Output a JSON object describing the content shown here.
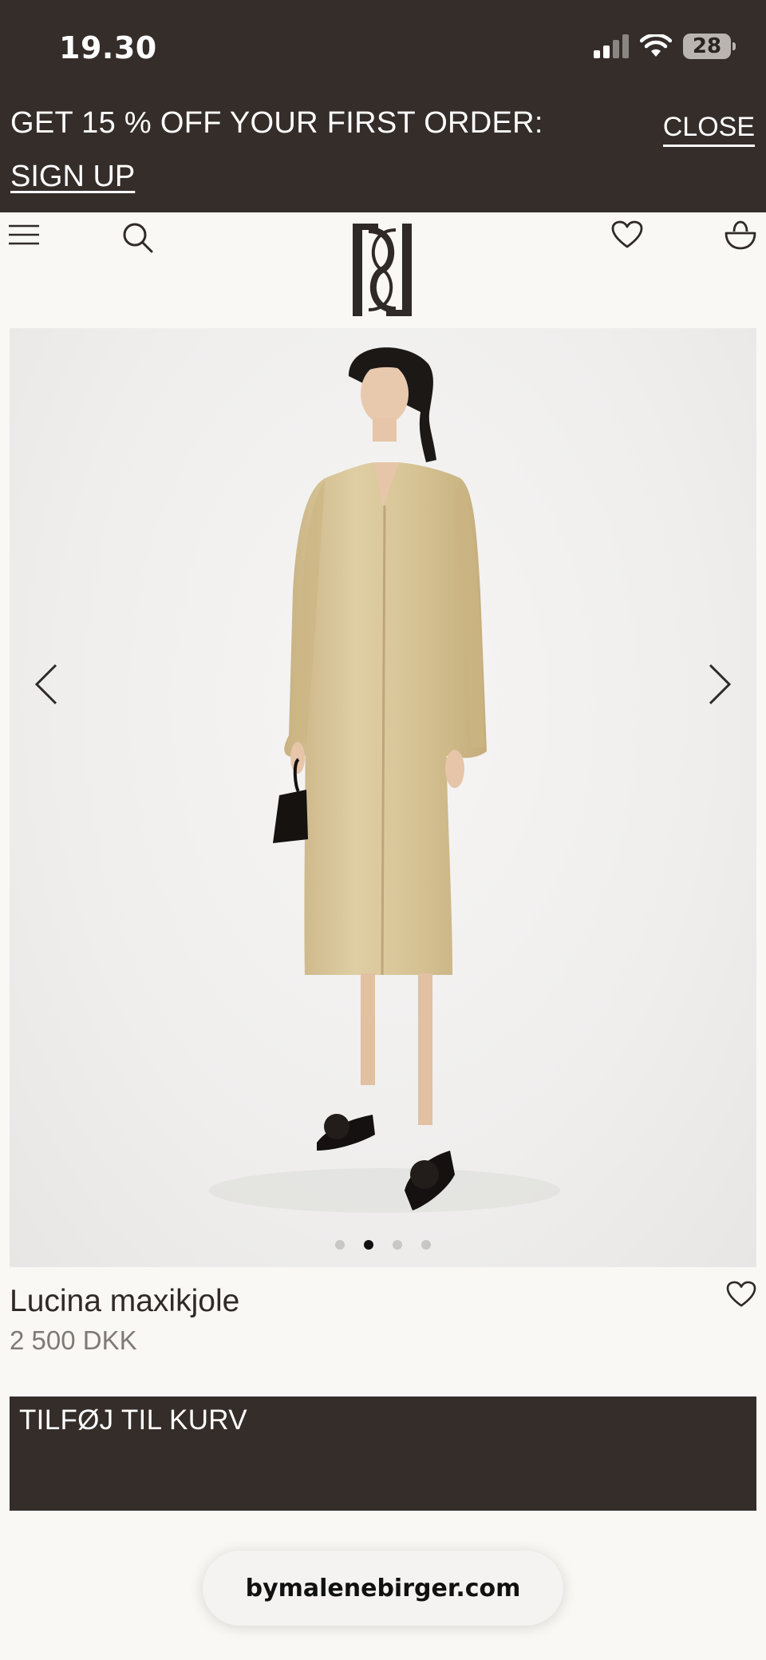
{
  "status_bar": {
    "time": "19.30",
    "battery": "28"
  },
  "promo": {
    "text": "GET 15 % OFF YOUR FIRST ORDER:",
    "close_label": "CLOSE",
    "signup_label": "SIGN UP"
  },
  "header": {
    "icons": [
      "menu-icon",
      "search-icon",
      "brand-logo",
      "heart-icon",
      "basket-icon"
    ]
  },
  "gallery": {
    "slides": 4,
    "active_slide": 2
  },
  "product": {
    "name": "Lucina maxikjole",
    "price": "2 500 DKK",
    "add_to_cart_label": "TILFØJ TIL KURV"
  },
  "browser": {
    "url": "bymalenebirger.com"
  },
  "colors": {
    "dark": "#342d2a",
    "background": "#faf8f5",
    "dress": "#d8c497"
  }
}
